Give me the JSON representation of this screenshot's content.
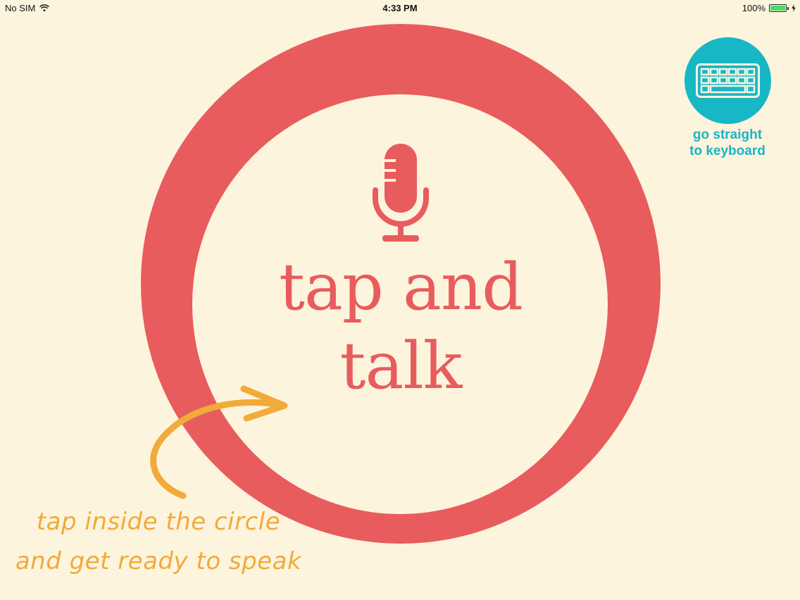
{
  "status_bar": {
    "carrier": "No SIM",
    "time": "4:33 PM",
    "battery_percent": "100%"
  },
  "main": {
    "line1": "tap and",
    "line2": "talk"
  },
  "keyboard_button": {
    "line1": "go straight",
    "line2": "to keyboard"
  },
  "hint": {
    "line1": "tap inside the circle",
    "line2": "and get ready to speak"
  },
  "colors": {
    "background": "#fdf4dd",
    "ring": "#e85c5e",
    "keyboard_button": "#18b7c6",
    "hint": "#f2aa3a"
  },
  "icons": {
    "mic": "microphone-icon",
    "keyboard": "keyboard-icon",
    "wifi": "wifi-icon",
    "battery": "battery-icon",
    "charging": "charging-bolt-icon",
    "arrow": "curved-arrow-icon"
  }
}
